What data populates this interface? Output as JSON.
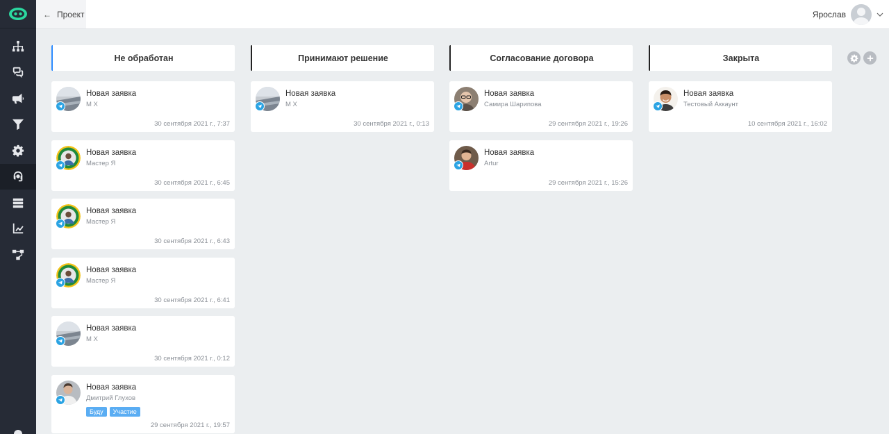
{
  "header": {
    "back_label": "Проект",
    "user_name": "Ярослав"
  },
  "sidebar": {
    "items": [
      {
        "icon": "sitemap-icon",
        "active": false
      },
      {
        "icon": "chat-icon",
        "active": false
      },
      {
        "icon": "megaphone-icon",
        "active": false
      },
      {
        "icon": "filter-icon",
        "active": false
      },
      {
        "icon": "gear-icon",
        "active": false
      },
      {
        "icon": "headset-icon",
        "active": true
      },
      {
        "icon": "server-icon",
        "active": false
      },
      {
        "icon": "chart-icon",
        "active": false
      },
      {
        "icon": "flow-icon",
        "active": false
      }
    ]
  },
  "board": {
    "columns": [
      {
        "title": "Не обработан",
        "cards": [
          {
            "title": "Новая заявка",
            "name": "М Х",
            "date": "30 сентября 2021 г., 7:37",
            "avatar": "sea"
          },
          {
            "title": "Новая заявка",
            "name": "Мастер Я",
            "date": "30 сентября 2021 г., 6:45",
            "avatar": "badge"
          },
          {
            "title": "Новая заявка",
            "name": "Мастер Я",
            "date": "30 сентября 2021 г., 6:43",
            "avatar": "badge"
          },
          {
            "title": "Новая заявка",
            "name": "Мастер Я",
            "date": "30 сентября 2021 г., 6:41",
            "avatar": "badge"
          },
          {
            "title": "Новая заявка",
            "name": "М Х",
            "date": "30 сентября 2021 г., 0:12",
            "avatar": "sea"
          },
          {
            "title": "Новая заявка",
            "name": "Дмитрий Глухов",
            "date": "29 сентября 2021 г., 19:57",
            "avatar": "man",
            "tags": [
              "Буду",
              "Участие"
            ]
          }
        ]
      },
      {
        "title": "Принимают решение",
        "cards": [
          {
            "title": "Новая заявка",
            "name": "М Х",
            "date": "30 сентября 2021 г., 0:13",
            "avatar": "sea"
          }
        ]
      },
      {
        "title": "Согласование договора",
        "cards": [
          {
            "title": "Новая заявка",
            "name": "Самира Шарипова",
            "date": "29 сентября 2021 г., 19:26",
            "avatar": "glasses"
          },
          {
            "title": "Новая заявка",
            "name": "Artur",
            "date": "29 сентября 2021 г., 15:26",
            "avatar": "redman"
          }
        ]
      },
      {
        "title": "Закрыта",
        "cards": [
          {
            "title": "Новая заявка",
            "name": "Тестовый Аккаунт",
            "date": "10 сентября 2021 г., 16:02",
            "avatar": "smile"
          }
        ]
      }
    ]
  },
  "colors": {
    "sidebar": "#262b36",
    "accent": "#2d8cff",
    "telegram": "#2aa3e3",
    "tag": "#5aadf3",
    "logo": "#2bd8a0"
  }
}
